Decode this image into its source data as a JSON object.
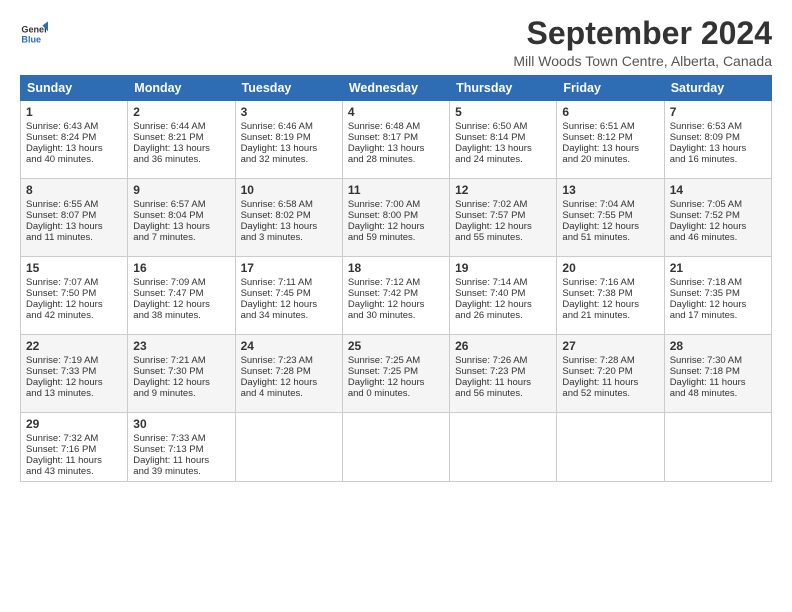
{
  "logo": {
    "line1": "General",
    "line2": "Blue"
  },
  "title": "September 2024",
  "location": "Mill Woods Town Centre, Alberta, Canada",
  "days_of_week": [
    "Sunday",
    "Monday",
    "Tuesday",
    "Wednesday",
    "Thursday",
    "Friday",
    "Saturday"
  ],
  "weeks": [
    [
      {
        "day": 1,
        "lines": [
          "Sunrise: 6:43 AM",
          "Sunset: 8:24 PM",
          "Daylight: 13 hours",
          "and 40 minutes."
        ]
      },
      {
        "day": 2,
        "lines": [
          "Sunrise: 6:44 AM",
          "Sunset: 8:21 PM",
          "Daylight: 13 hours",
          "and 36 minutes."
        ]
      },
      {
        "day": 3,
        "lines": [
          "Sunrise: 6:46 AM",
          "Sunset: 8:19 PM",
          "Daylight: 13 hours",
          "and 32 minutes."
        ]
      },
      {
        "day": 4,
        "lines": [
          "Sunrise: 6:48 AM",
          "Sunset: 8:17 PM",
          "Daylight: 13 hours",
          "and 28 minutes."
        ]
      },
      {
        "day": 5,
        "lines": [
          "Sunrise: 6:50 AM",
          "Sunset: 8:14 PM",
          "Daylight: 13 hours",
          "and 24 minutes."
        ]
      },
      {
        "day": 6,
        "lines": [
          "Sunrise: 6:51 AM",
          "Sunset: 8:12 PM",
          "Daylight: 13 hours",
          "and 20 minutes."
        ]
      },
      {
        "day": 7,
        "lines": [
          "Sunrise: 6:53 AM",
          "Sunset: 8:09 PM",
          "Daylight: 13 hours",
          "and 16 minutes."
        ]
      }
    ],
    [
      {
        "day": 8,
        "lines": [
          "Sunrise: 6:55 AM",
          "Sunset: 8:07 PM",
          "Daylight: 13 hours",
          "and 11 minutes."
        ]
      },
      {
        "day": 9,
        "lines": [
          "Sunrise: 6:57 AM",
          "Sunset: 8:04 PM",
          "Daylight: 13 hours",
          "and 7 minutes."
        ]
      },
      {
        "day": 10,
        "lines": [
          "Sunrise: 6:58 AM",
          "Sunset: 8:02 PM",
          "Daylight: 13 hours",
          "and 3 minutes."
        ]
      },
      {
        "day": 11,
        "lines": [
          "Sunrise: 7:00 AM",
          "Sunset: 8:00 PM",
          "Daylight: 12 hours",
          "and 59 minutes."
        ]
      },
      {
        "day": 12,
        "lines": [
          "Sunrise: 7:02 AM",
          "Sunset: 7:57 PM",
          "Daylight: 12 hours",
          "and 55 minutes."
        ]
      },
      {
        "day": 13,
        "lines": [
          "Sunrise: 7:04 AM",
          "Sunset: 7:55 PM",
          "Daylight: 12 hours",
          "and 51 minutes."
        ]
      },
      {
        "day": 14,
        "lines": [
          "Sunrise: 7:05 AM",
          "Sunset: 7:52 PM",
          "Daylight: 12 hours",
          "and 46 minutes."
        ]
      }
    ],
    [
      {
        "day": 15,
        "lines": [
          "Sunrise: 7:07 AM",
          "Sunset: 7:50 PM",
          "Daylight: 12 hours",
          "and 42 minutes."
        ]
      },
      {
        "day": 16,
        "lines": [
          "Sunrise: 7:09 AM",
          "Sunset: 7:47 PM",
          "Daylight: 12 hours",
          "and 38 minutes."
        ]
      },
      {
        "day": 17,
        "lines": [
          "Sunrise: 7:11 AM",
          "Sunset: 7:45 PM",
          "Daylight: 12 hours",
          "and 34 minutes."
        ]
      },
      {
        "day": 18,
        "lines": [
          "Sunrise: 7:12 AM",
          "Sunset: 7:42 PM",
          "Daylight: 12 hours",
          "and 30 minutes."
        ]
      },
      {
        "day": 19,
        "lines": [
          "Sunrise: 7:14 AM",
          "Sunset: 7:40 PM",
          "Daylight: 12 hours",
          "and 26 minutes."
        ]
      },
      {
        "day": 20,
        "lines": [
          "Sunrise: 7:16 AM",
          "Sunset: 7:38 PM",
          "Daylight: 12 hours",
          "and 21 minutes."
        ]
      },
      {
        "day": 21,
        "lines": [
          "Sunrise: 7:18 AM",
          "Sunset: 7:35 PM",
          "Daylight: 12 hours",
          "and 17 minutes."
        ]
      }
    ],
    [
      {
        "day": 22,
        "lines": [
          "Sunrise: 7:19 AM",
          "Sunset: 7:33 PM",
          "Daylight: 12 hours",
          "and 13 minutes."
        ]
      },
      {
        "day": 23,
        "lines": [
          "Sunrise: 7:21 AM",
          "Sunset: 7:30 PM",
          "Daylight: 12 hours",
          "and 9 minutes."
        ]
      },
      {
        "day": 24,
        "lines": [
          "Sunrise: 7:23 AM",
          "Sunset: 7:28 PM",
          "Daylight: 12 hours",
          "and 4 minutes."
        ]
      },
      {
        "day": 25,
        "lines": [
          "Sunrise: 7:25 AM",
          "Sunset: 7:25 PM",
          "Daylight: 12 hours",
          "and 0 minutes."
        ]
      },
      {
        "day": 26,
        "lines": [
          "Sunrise: 7:26 AM",
          "Sunset: 7:23 PM",
          "Daylight: 11 hours",
          "and 56 minutes."
        ]
      },
      {
        "day": 27,
        "lines": [
          "Sunrise: 7:28 AM",
          "Sunset: 7:20 PM",
          "Daylight: 11 hours",
          "and 52 minutes."
        ]
      },
      {
        "day": 28,
        "lines": [
          "Sunrise: 7:30 AM",
          "Sunset: 7:18 PM",
          "Daylight: 11 hours",
          "and 48 minutes."
        ]
      }
    ],
    [
      {
        "day": 29,
        "lines": [
          "Sunrise: 7:32 AM",
          "Sunset: 7:16 PM",
          "Daylight: 11 hours",
          "and 43 minutes."
        ]
      },
      {
        "day": 30,
        "lines": [
          "Sunrise: 7:33 AM",
          "Sunset: 7:13 PM",
          "Daylight: 11 hours",
          "and 39 minutes."
        ]
      },
      null,
      null,
      null,
      null,
      null
    ]
  ]
}
